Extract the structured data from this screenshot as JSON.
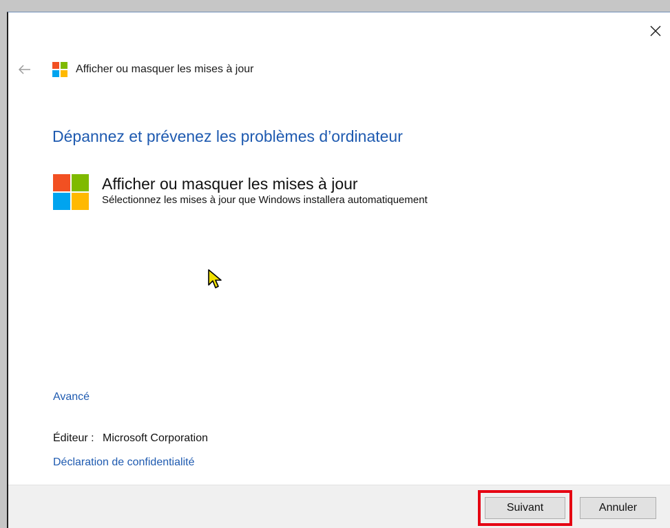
{
  "window": {
    "title": "Afficher ou masquer les mises à jour",
    "close_icon": "close-icon",
    "back_icon": "back-arrow-icon"
  },
  "main": {
    "heading": "Dépannez et prévenez les problèmes d’ordinateur",
    "task_title": "Afficher ou masquer les mises à jour",
    "task_description": "Sélectionnez les mises à jour que Windows installera automatiquement",
    "advanced_link": "Avancé",
    "publisher_label": "Éditeur :",
    "publisher_value": "Microsoft Corporation",
    "privacy_link": "Déclaration de confidentialité"
  },
  "footer": {
    "next_label": "Suivant",
    "cancel_label": "Annuler"
  },
  "colors": {
    "link_blue": "#1e5ab0",
    "logo_red": "#f25022",
    "logo_green": "#7fba00",
    "logo_blue": "#00a4ef",
    "logo_yellow": "#ffb900",
    "highlight_red": "#e50012"
  }
}
